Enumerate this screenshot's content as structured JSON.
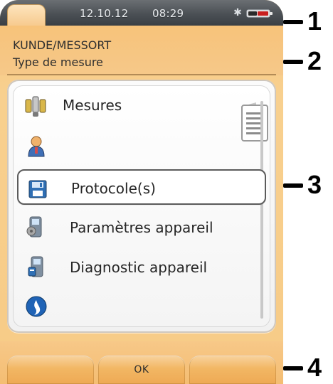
{
  "statusbar": {
    "date": "12.10.12",
    "time": "08:29"
  },
  "title": {
    "line1": "KUNDE/MESSORT",
    "line2": "Type de mesure"
  },
  "menu": {
    "items": [
      {
        "label": "Mesures",
        "icon": "measurement-probe-icon"
      },
      {
        "label": "",
        "icon": "user-icon"
      },
      {
        "label": "Protocole(s)",
        "icon": "floppy-disk-icon",
        "selected": true
      },
      {
        "label": "Paramètres appareil",
        "icon": "device-settings-icon"
      },
      {
        "label": "Diagnostic appareil",
        "icon": "device-diagnostics-icon"
      },
      {
        "label": "",
        "icon": "info-icon"
      }
    ]
  },
  "softkeys": {
    "left": "",
    "center": "OK",
    "right": ""
  },
  "callouts": {
    "n1": "1",
    "n2": "2",
    "n3": "3",
    "n4": "4"
  },
  "colors": {
    "screen_bg": "#F7C77F",
    "statusbar_bg": "#4B5055",
    "panel_bg": "#F4F4F4",
    "selected_border": "#5B5B5B",
    "softkey": "#F2B764",
    "callout": "#000000"
  }
}
